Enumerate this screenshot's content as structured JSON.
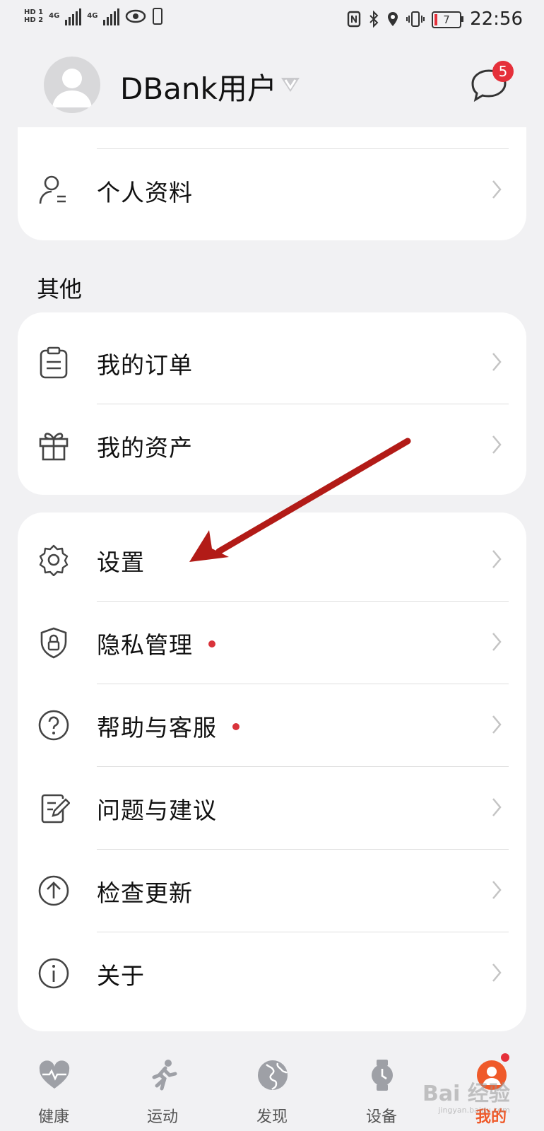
{
  "status_bar": {
    "sim1": "HD 1",
    "sim2": "HD 2",
    "net1": "4G",
    "net2": "4G",
    "battery_level": "7",
    "time": "22:56"
  },
  "header": {
    "username": "DBank用户",
    "message_badge": "5"
  },
  "account_section": {
    "items": [
      {
        "label": "个人资料",
        "icon": "person-profile-icon"
      }
    ]
  },
  "other_section": {
    "title": "其他",
    "items": [
      {
        "label": "我的订单",
        "icon": "clipboard-icon"
      },
      {
        "label": "我的资产",
        "icon": "gift-icon"
      }
    ]
  },
  "settings_section": {
    "items": [
      {
        "label": "设置",
        "icon": "gear-icon",
        "dot": false
      },
      {
        "label": "隐私管理",
        "icon": "shield-lock-icon",
        "dot": true
      },
      {
        "label": "帮助与客服",
        "icon": "question-circle-icon",
        "dot": true
      },
      {
        "label": "问题与建议",
        "icon": "edit-note-icon",
        "dot": false
      },
      {
        "label": "检查更新",
        "icon": "arrow-up-circle-icon",
        "dot": false
      },
      {
        "label": "关于",
        "icon": "info-circle-icon",
        "dot": false
      }
    ]
  },
  "tab_bar": {
    "tabs": [
      {
        "label": "健康",
        "icon": "heart-pulse-icon",
        "active": false
      },
      {
        "label": "运动",
        "icon": "runner-icon",
        "active": false
      },
      {
        "label": "发现",
        "icon": "globe-icon",
        "active": false
      },
      {
        "label": "设备",
        "icon": "watch-icon",
        "active": false
      },
      {
        "label": "我的",
        "icon": "user-icon",
        "active": true
      }
    ]
  },
  "watermark": {
    "text": "Bai 经验",
    "sub": "jingyan.baidu.com"
  },
  "colors": {
    "accent": "#ef5a2a",
    "badge_red": "#e5303a",
    "annotation_arrow": "#b21b17",
    "background": "#f1f1f3"
  }
}
